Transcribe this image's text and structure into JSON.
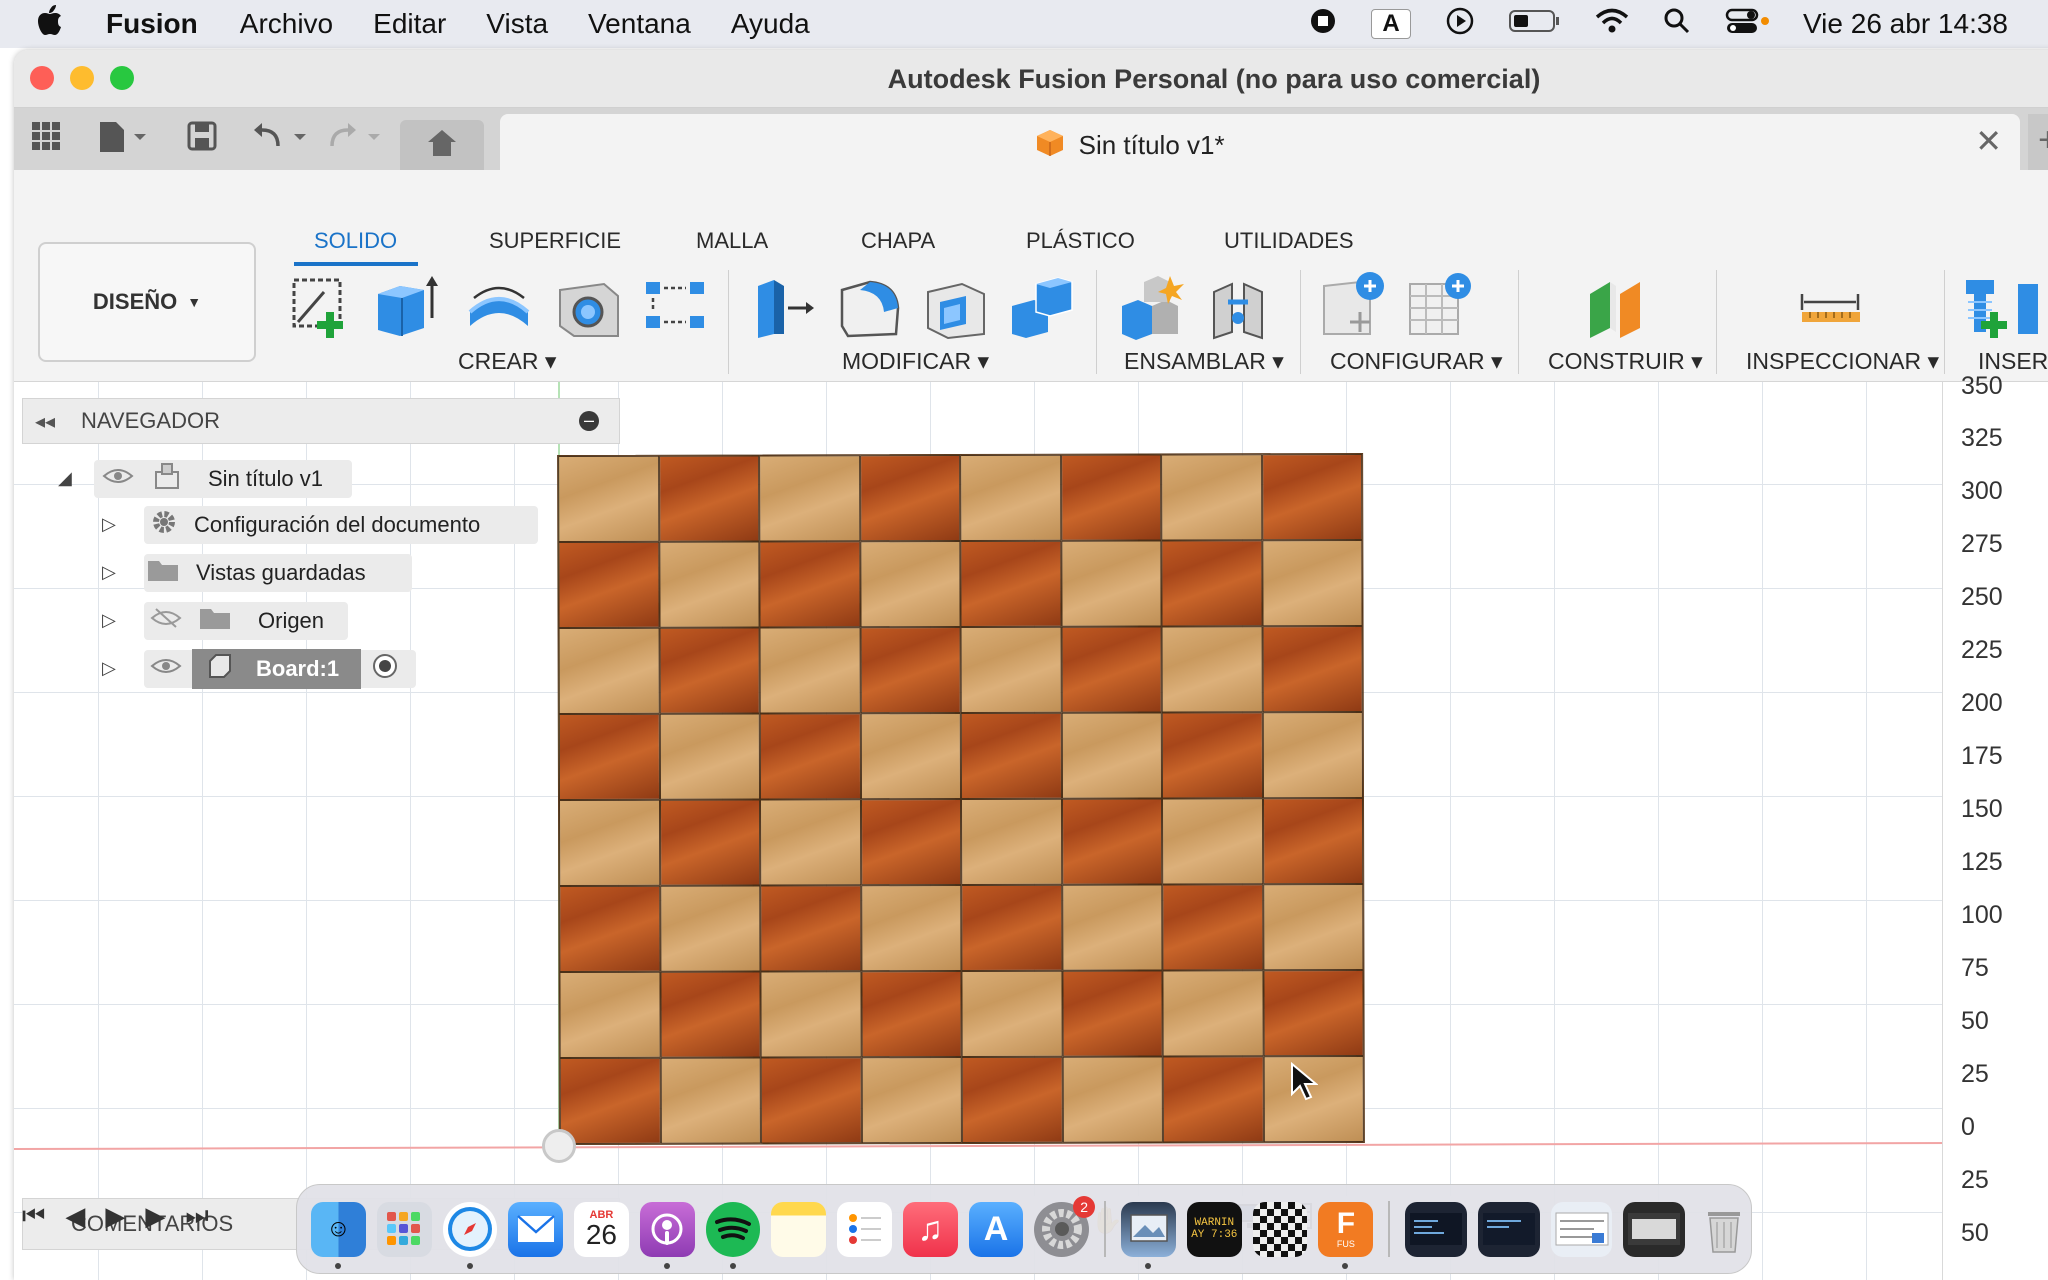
{
  "menubar": {
    "app_name": "Fusion",
    "items": [
      "Archivo",
      "Editar",
      "Vista",
      "Ventana",
      "Ayuda"
    ],
    "input_indicator": "A",
    "clock": "Vie 26 abr 14:38"
  },
  "window": {
    "title": "Autodesk Fusion Personal (no para uso comercial)",
    "document_tab": "Sin título v1*"
  },
  "toolbar": {
    "workspace": "DISEÑO",
    "tabs": [
      "SOLIDO",
      "SUPERFICIE",
      "MALLA",
      "CHAPA",
      "PLÁSTICO",
      "UTILIDADES"
    ],
    "active_tab": "SOLIDO",
    "groups": [
      "CREAR",
      "MODIFICAR",
      "ENSAMBLAR",
      "CONFIGURAR",
      "CONSTRUIR",
      "INSPECCIONAR",
      "INSERTA"
    ]
  },
  "browser": {
    "title": "NAVEGADOR",
    "root": "Sin título v1",
    "items": [
      "Configuración del documento",
      "Vistas guardadas",
      "Origen",
      "Board:1"
    ]
  },
  "comments": {
    "title": "COMENTARIOS"
  },
  "ruler": {
    "labels": [
      "350",
      "325",
      "300",
      "275",
      "250",
      "225",
      "200",
      "175",
      "150",
      "125",
      "100",
      "75",
      "50",
      "25",
      "0",
      "25",
      "50"
    ]
  },
  "dock": {
    "calendar": {
      "month": "ABR",
      "day": "26"
    },
    "settings_badge": "2",
    "warning_text": "WARNIN",
    "warning_time": "AY 7:36",
    "fusion_label": "F",
    "fusion_sub": "FUS"
  },
  "board": {
    "rows": 8,
    "cols": 8
  },
  "colors": {
    "accent": "#1a73c8",
    "light_wood": "#d2a56c",
    "dark_wood": "#b04e1d"
  }
}
